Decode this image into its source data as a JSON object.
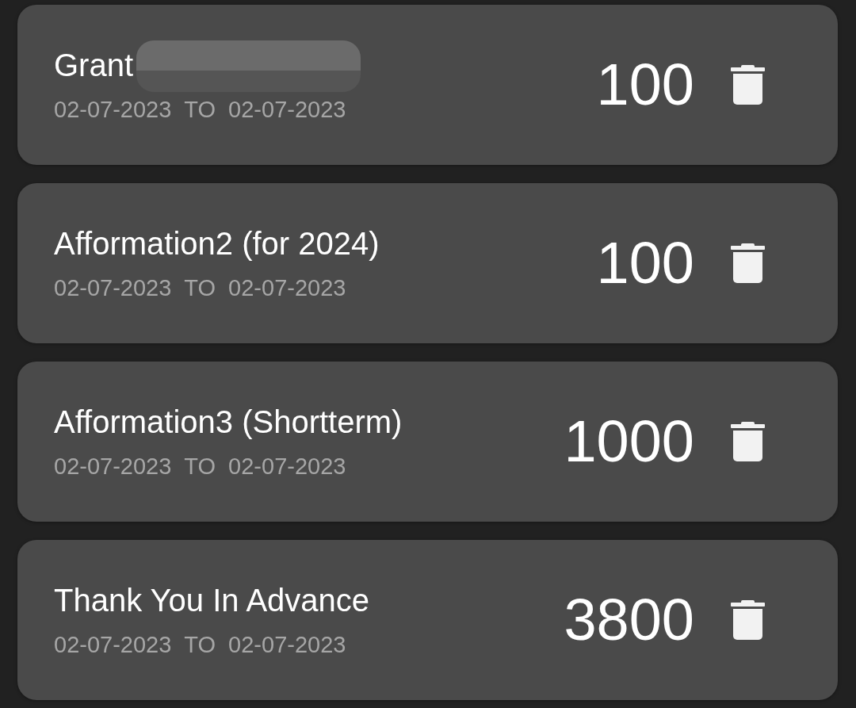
{
  "items": [
    {
      "title": "Grant",
      "redacted": true,
      "start_date": "02-07-2023",
      "separator": "TO",
      "end_date": "02-07-2023",
      "amount": "100"
    },
    {
      "title": "Afformation2 (for 2024)",
      "redacted": false,
      "start_date": "02-07-2023",
      "separator": "TO",
      "end_date": "02-07-2023",
      "amount": "100"
    },
    {
      "title": "Afformation3 (Shortterm)",
      "redacted": false,
      "start_date": "02-07-2023",
      "separator": "TO",
      "end_date": "02-07-2023",
      "amount": "1000"
    },
    {
      "title": "Thank You In Advance",
      "redacted": false,
      "start_date": "02-07-2023",
      "separator": "TO",
      "end_date": "02-07-2023",
      "amount": "3800"
    }
  ]
}
